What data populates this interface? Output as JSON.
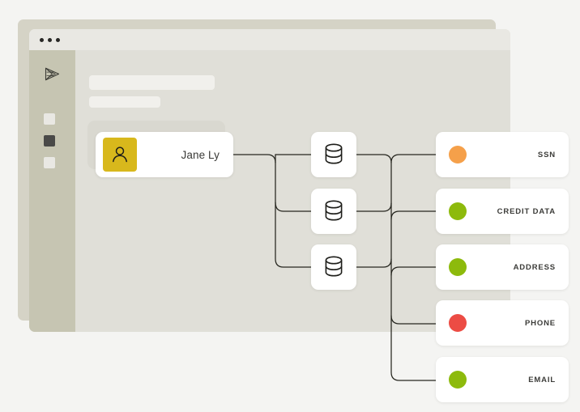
{
  "window": {
    "titlebar_dots": [
      "dot-red",
      "dot-yellow",
      "dot-green"
    ],
    "logo_icon": "play-triangle-logo-icon"
  },
  "sidebar": {
    "items": [
      {
        "name": "nav-square-1",
        "state": "inactive"
      },
      {
        "name": "nav-square-2",
        "state": "active"
      },
      {
        "name": "nav-square-3",
        "state": "inactive"
      }
    ]
  },
  "content": {
    "placeholder_bars": [
      "",
      ""
    ]
  },
  "graph": {
    "person": {
      "name": "Jane Ly",
      "avatar_icon": "person-icon",
      "avatar_color": "#D8B81C"
    },
    "databases": [
      {
        "id": "db-1",
        "icon": "database-icon"
      },
      {
        "id": "db-2",
        "icon": "database-icon"
      },
      {
        "id": "db-3",
        "icon": "database-icon"
      }
    ],
    "data_types": [
      {
        "label": "SSN",
        "color": "#F5A04A"
      },
      {
        "label": "CREDIT DATA",
        "color": "#8DBA0C"
      },
      {
        "label": "ADDRESS",
        "color": "#8DBA0C"
      },
      {
        "label": "PHONE",
        "color": "#EC4C44"
      },
      {
        "label": "EMAIL",
        "color": "#8DBA0C"
      }
    ]
  },
  "colors": {
    "page_background": "#F4F4F2",
    "window_back": "#D5D3C6",
    "window_front": "#E0DFD8",
    "titlebar": "#E9E8E3",
    "sidebar": "#C6C5B2",
    "nav_active": "#4A4A48",
    "wire": "#26261F"
  }
}
